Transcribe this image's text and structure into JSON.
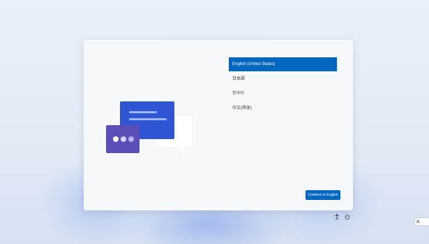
{
  "languages": [
    {
      "label": "English (United States)",
      "selected": true
    },
    {
      "label": "日本語",
      "selected": false
    },
    {
      "label": "한국어",
      "selected": false
    },
    {
      "label": "中文(简体)",
      "selected": false
    }
  ],
  "continue_button": {
    "label": "Continue in English"
  },
  "ime_indicator": {
    "label": "A"
  },
  "tray_icons": [
    "accessibility-icon",
    "power-icon"
  ],
  "colors": {
    "accent": "#0067c0",
    "card_background": "#f6f9fc",
    "illustration_blue": "#2f55d4",
    "illustration_purple": "#5a4fb8"
  }
}
